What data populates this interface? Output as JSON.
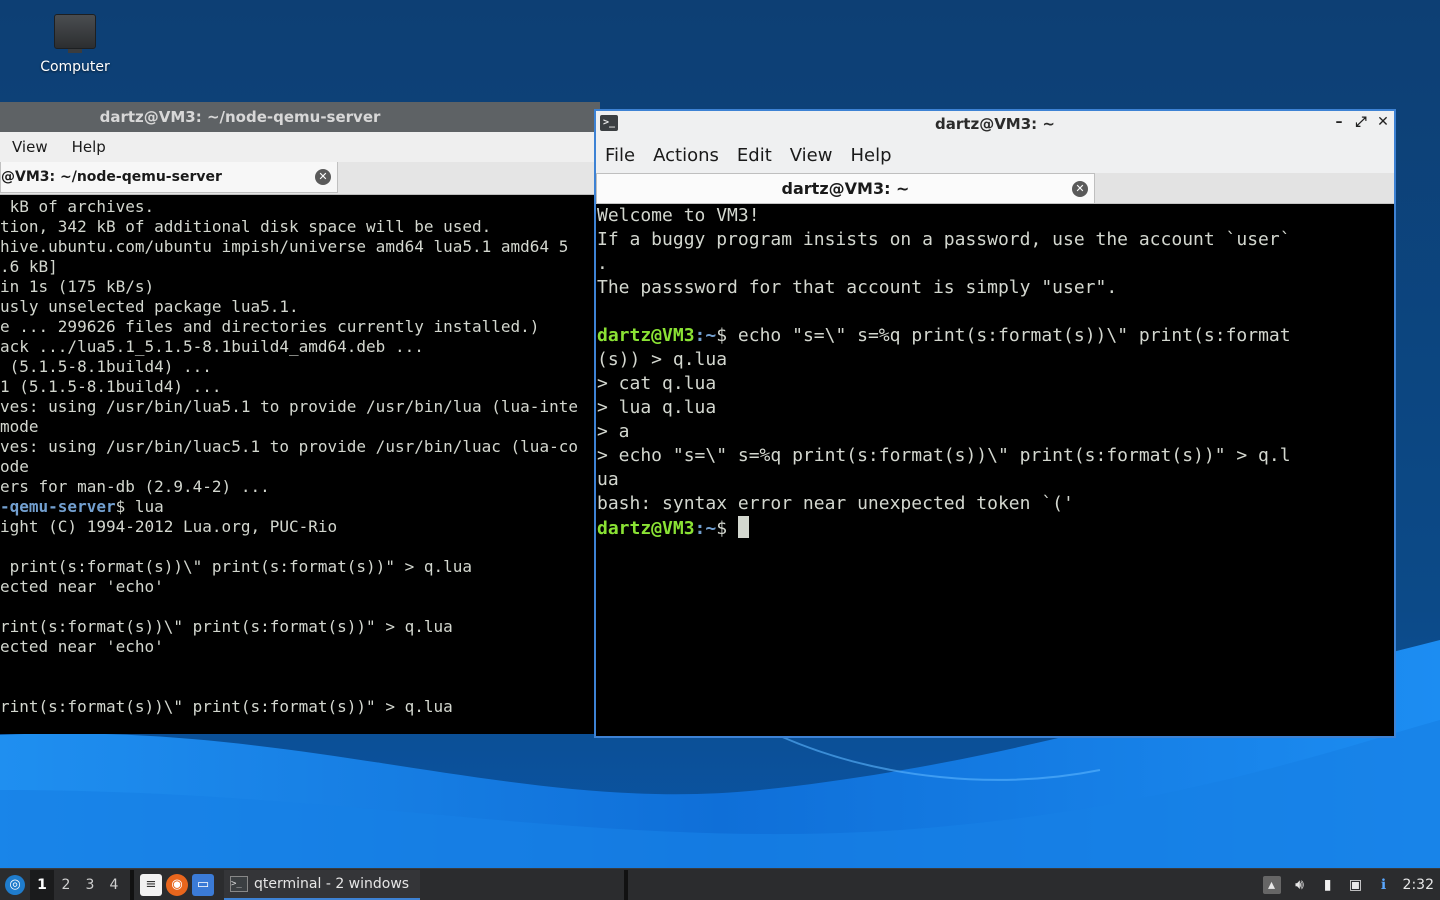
{
  "desktop": {
    "icons": [
      {
        "label": "Computer",
        "icon": "computer-icon"
      }
    ]
  },
  "left_window": {
    "title": "dartz@VM3: ~/node-qemu-server",
    "menu": [
      "View",
      "Help"
    ],
    "tab_label": "@VM3: ~/node-qemu-server",
    "lines": [
      " kB of archives.",
      "tion, 342 kB of additional disk space will be used.",
      "hive.ubuntu.com/ubuntu impish/universe amd64 lua5.1 amd64 5",
      ".6 kB]",
      "in 1s (175 kB/s)",
      "usly unselected package lua5.1.",
      "e ... 299626 files and directories currently installed.)",
      "ack .../lua5.1_5.1.5-8.1build4_amd64.deb ...",
      " (5.1.5-8.1build4) ...",
      "1 (5.1.5-8.1build4) ...",
      "ves: using /usr/bin/lua5.1 to provide /usr/bin/lua (lua-inte",
      "mode",
      "ves: using /usr/bin/luac5.1 to provide /usr/bin/luac (lua-co",
      "ode",
      "ers for man-db (2.9.4-2) ...",
      "-qemu-server$ lua",
      "ight (C) 1994-2012 Lua.org, PUC-Rio",
      "",
      " print(s:format(s))\\\" print(s:format(s))\" > q.lua",
      "ected near 'echo'",
      "",
      "rint(s:format(s))\\\" print(s:format(s))\" > q.lua",
      "ected near 'echo'",
      "",
      "",
      "rint(s:format(s))\\\" print(s:format(s))\" > q.lua"
    ]
  },
  "right_window": {
    "title": "dartz@VM3: ~",
    "menu": [
      "File",
      "Actions",
      "Edit",
      "View",
      "Help"
    ],
    "tab_label": "dartz@VM3: ~",
    "prompt_user": "dartz@VM3",
    "prompt_path": ":~",
    "prompt_sym": "$ ",
    "welcome_lines": [
      "Welcome to VM3!",
      "If a buggy program insists on a password, use the account `user`",
      ".",
      "The passsword for that account is simply \"user\".",
      ""
    ],
    "command_line_1": "echo \"s=\\\" s=%q print(s:format(s))\\\" print(s:format",
    "output_lines": [
      "(s)) > q.lua",
      "> cat q.lua",
      "> lua q.lua",
      "> a",
      "> echo \"s=\\\" s=%q print(s:format(s))\\\" print(s:format(s))\" > q.l",
      "ua",
      "bash: syntax error near unexpected token `('"
    ]
  },
  "taskbar": {
    "workspaces": [
      "1",
      "2",
      "3",
      "4"
    ],
    "active_workspace": "1",
    "task_label": "qterminal - 2 windows",
    "clock": "2:32"
  },
  "colors": {
    "accent": "#3d82d4",
    "prompt_user": "#8ae234",
    "prompt_path": "#729fcf"
  }
}
